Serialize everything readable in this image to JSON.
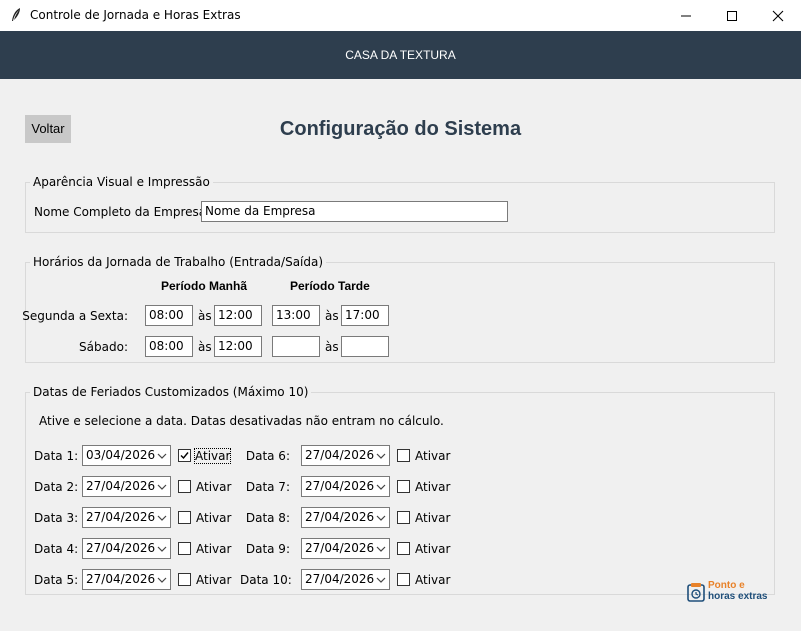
{
  "window": {
    "title": "Controle de Jornada e Horas Extras",
    "icon": "feather-icon",
    "controls": [
      "minimize-icon",
      "maximize-icon",
      "close-icon"
    ]
  },
  "header": {
    "brand": "CASA DA TEXTURA",
    "background": "#2e3e4e"
  },
  "toolbar": {
    "back_label": "Voltar"
  },
  "page": {
    "title": "Configuração do Sistema",
    "title_color": "#2e3e4e"
  },
  "appearance": {
    "group_title": "Aparência Visual e Impressão",
    "company_label": "Nome Completo da Empresa:",
    "company_value": "Nome da Empresa"
  },
  "schedule": {
    "group_title": "Horários da Jornada de Trabalho (Entrada/Saída)",
    "morning_header": "Período Manhã",
    "afternoon_header": "Período Tarde",
    "separator": "às",
    "rows": [
      {
        "label": "Segunda a Sexta:",
        "m_in": "08:00",
        "m_out": "12:00",
        "a_in": "13:00",
        "a_out": "17:00"
      },
      {
        "label": "Sábado:",
        "m_in": "08:00",
        "m_out": "12:00",
        "a_in": "",
        "a_out": ""
      }
    ]
  },
  "holidays": {
    "group_title": "Datas de Feriados Customizados (Máximo 10)",
    "hint": "Ative e selecione a data. Datas desativadas não entram no cálculo.",
    "activate_label": "Ativar",
    "items": [
      {
        "label": "Data 1:",
        "date": "03/04/2026",
        "active": true
      },
      {
        "label": "Data 2:",
        "date": "27/04/2026",
        "active": false
      },
      {
        "label": "Data 3:",
        "date": "27/04/2026",
        "active": false
      },
      {
        "label": "Data 4:",
        "date": "27/04/2026",
        "active": false
      },
      {
        "label": "Data 5:",
        "date": "27/04/2026",
        "active": false
      },
      {
        "label": "Data 6:",
        "date": "27/04/2026",
        "active": false
      },
      {
        "label": "Data 7:",
        "date": "27/04/2026",
        "active": false
      },
      {
        "label": "Data 8:",
        "date": "27/04/2026",
        "active": false
      },
      {
        "label": "Data 9:",
        "date": "27/04/2026",
        "active": false
      },
      {
        "label": "Data 10:",
        "date": "27/04/2026",
        "active": false
      }
    ]
  },
  "logo": {
    "line1": "Ponto e",
    "line2": "horas extras",
    "color1": "#e8822a",
    "color2": "#1f4f7a"
  }
}
